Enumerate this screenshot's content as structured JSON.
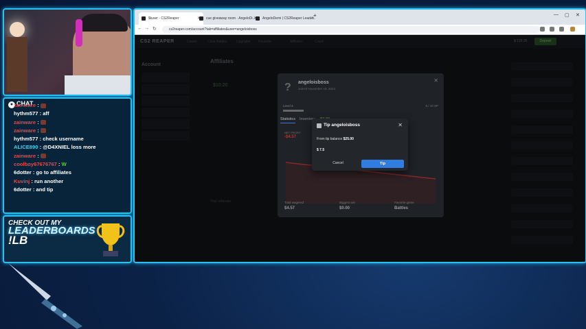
{
  "chat": {
    "logo": "CHAT",
    "messages": [
      {
        "user": "zainware",
        "text": "",
        "color": "red",
        "emote": true
      },
      {
        "user": "hythm577",
        "text": "aff",
        "color": "white"
      },
      {
        "user": "zainware",
        "text": "",
        "color": "red",
        "emote": true
      },
      {
        "user": "zainware",
        "text": "",
        "color": "red",
        "emote": true
      },
      {
        "user": "hythm577",
        "text": "check username",
        "color": "white"
      },
      {
        "user": "ALICE890",
        "text": "@D4XNIEL loss more",
        "color": "cyan"
      },
      {
        "user": "zainware",
        "text": "",
        "color": "red",
        "emote": true
      },
      {
        "user": "coolboy67676767",
        "text": "W",
        "color": "red"
      },
      {
        "user": "6dotter",
        "text": "go to affiliates",
        "color": "white"
      },
      {
        "user": "Kuvinj",
        "text": "run another",
        "color": "red"
      },
      {
        "user": "6dotter",
        "text": "and tip",
        "color": "white"
      }
    ]
  },
  "leaderboard": {
    "line1": "CHECK OUT MY",
    "line2": "LEADERBOARDS",
    "line3": "!LB"
  },
  "browser": {
    "tabs": [
      {
        "label": "$tuser - CS2Reaper"
      },
      {
        "label": "cue giveaway room · AngeloDi..."
      },
      {
        "label": "AngeloDemi | CS2Reaper Leade..."
      }
    ],
    "url": "cs2reaper.com/account?tab=affiliates&user=angeloisboss",
    "site": {
      "logo": "CS2 REAPER",
      "nav": [
        "Cases",
        "Case Battles",
        "Upgrader",
        "Roulette",
        "Affiliates",
        "Crash"
      ],
      "balance": "$ 126.35",
      "deposit_label": "Deposit",
      "page_title": "Affiliates",
      "sidebar_title": "Account",
      "table_header": "Your referrals",
      "stats_value": "$10.20"
    },
    "profile_modal": {
      "initial": "?",
      "username": "angeloisboss",
      "joined": "Joined November 19, 2024",
      "level": "Level 3",
      "xp": "5 / 10 XP",
      "tab_statistics": "Statistics",
      "tab_inventory": "Inventory",
      "inventory_value": "$0.00",
      "net_profit_label": "NET PROFIT",
      "net_profit_value": "-$4.57",
      "stats": [
        {
          "label": "Total wagered",
          "value": "$4.57"
        },
        {
          "label": "Biggest win",
          "value": "$0.00"
        },
        {
          "label": "Favorite game",
          "value": "Battles"
        }
      ]
    },
    "tip_dialog": {
      "title": "Tip angeloisboss",
      "balance_prefix": "From tip balance",
      "balance_value": "$25.00",
      "amount": "$ 7.5",
      "cancel_label": "Cancel",
      "tip_label": "Tip"
    }
  }
}
